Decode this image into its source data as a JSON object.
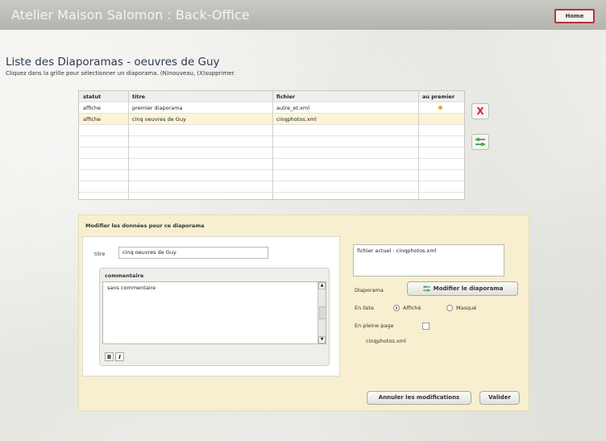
{
  "app": {
    "title": "Atelier Maison Salomon : Back-Office",
    "home_label": "Home"
  },
  "page": {
    "title": "Liste des Diaporamas - oeuvres de Guy",
    "instructions": "Cliquez dans la grille pour sélectionner un diaporama. (N)nouveau, (X)supprimer."
  },
  "grid": {
    "columns": [
      "statut",
      "titre",
      "fichier",
      "au premier"
    ],
    "rows": [
      {
        "statut": "affiche",
        "titre": "premier diaporama",
        "fichier": "autre_et.xml",
        "premier": true
      },
      {
        "statut": "affiche",
        "titre": "cinq oeuvres de Guy",
        "fichier": "cinqphotos.xml",
        "premier": false
      }
    ]
  },
  "side_actions": {
    "delete_icon": "X",
    "settings_icon": "sliders-icon"
  },
  "edit": {
    "panel_title": "Modifier les données pour ce diaporama",
    "titre_label": "titre",
    "titre_value": "cinq oeuvres de Guy",
    "comment_title": "commentaire",
    "comment_value": "sans commentaire",
    "bold_label": "B",
    "italic_label": "I",
    "file_current": "fichier actuel : cinqphotos.xml",
    "diaporama_label": "Diaporama",
    "modify_button": "Modifier le diaporama",
    "en_liste_label": "En liste",
    "affiche_label": "Affiché",
    "masque_label": "Masqué",
    "pleine_page_label": "En pleine page",
    "file_name": "cinqphotos.xml",
    "cancel_button": "Annuler les modifications",
    "validate_button": "Valider"
  }
}
